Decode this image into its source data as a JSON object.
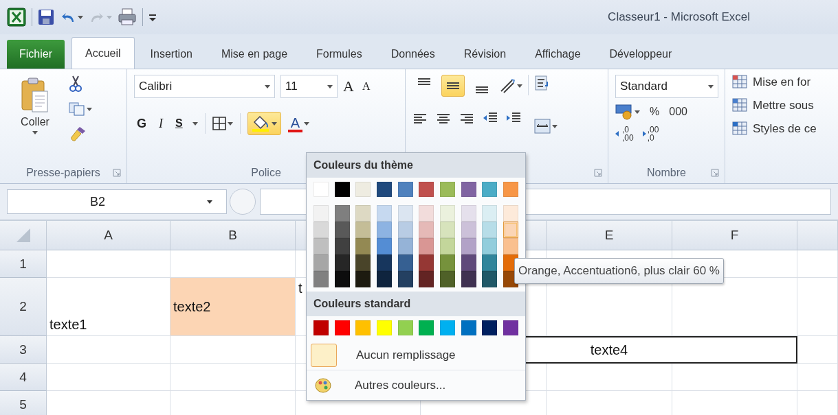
{
  "window": {
    "title": "Classeur1 - Microsoft Excel"
  },
  "tabs": [
    {
      "label": "Fichier",
      "kind": "file",
      "selected": false
    },
    {
      "label": "Accueil",
      "kind": "tab",
      "selected": true
    },
    {
      "label": "Insertion",
      "kind": "tab",
      "selected": false
    },
    {
      "label": "Mise en page",
      "kind": "tab",
      "selected": false
    },
    {
      "label": "Formules",
      "kind": "tab",
      "selected": false
    },
    {
      "label": "Données",
      "kind": "tab",
      "selected": false
    },
    {
      "label": "Révision",
      "kind": "tab",
      "selected": false
    },
    {
      "label": "Affichage",
      "kind": "tab",
      "selected": false
    },
    {
      "label": "Développeur",
      "kind": "tab",
      "selected": false
    }
  ],
  "ribbon": {
    "clipboard": {
      "paste_label": "Coller",
      "group_label": "Presse-papiers"
    },
    "font": {
      "family": "Calibri",
      "size": "11",
      "grow": "A",
      "shrink": "A",
      "bold": "G",
      "italic": "I",
      "underline": "S",
      "font_color": "A",
      "fill_open": true,
      "group_label": "Police"
    },
    "alignment": {
      "vertical": [
        {
          "selected": false
        },
        {
          "selected": true
        },
        {
          "selected": false
        }
      ]
    },
    "number": {
      "format": "Standard",
      "percent": "%",
      "thousands": "000",
      "decimals": [
        {
          "lines": [
            ",0",
            ",00"
          ]
        },
        {
          "lines": [
            ",00",
            ",0"
          ]
        }
      ],
      "group_label": "Nombre"
    },
    "styles": {
      "items": [
        {
          "label": "Mise en for"
        },
        {
          "label": "Mettre sous"
        },
        {
          "label": "Styles de ce"
        }
      ]
    }
  },
  "formula_bar": {
    "name_box": "B2"
  },
  "sheet": {
    "columns": [
      {
        "label": "A"
      },
      {
        "label": "B"
      },
      {},
      {},
      {
        "label": "E"
      },
      {
        "label": "F"
      },
      {}
    ],
    "rows": [
      {
        "label": "1",
        "cells": [
          {},
          {},
          {},
          {},
          {},
          {},
          {}
        ]
      },
      {
        "label": "2",
        "cells": [
          {
            "text": "texte1",
            "at_bottom": true
          },
          {
            "text": "texte2",
            "color": "#fcd5b4"
          },
          {
            "text": "t",
            "at_top": true
          },
          {},
          {},
          {},
          {}
        ]
      },
      {
        "label": "3",
        "cells": [
          {},
          {},
          {},
          {
            "text": "texte4",
            "bordered": true,
            "merge_right": true
          },
          {
            "merge_right": true
          },
          {},
          {}
        ]
      },
      {
        "label": "4",
        "cells": [
          {},
          {},
          {},
          {},
          {},
          {},
          {}
        ]
      },
      {
        "label": "5",
        "cells": [
          {},
          {},
          {},
          {},
          {},
          {},
          {}
        ]
      }
    ]
  },
  "fill_menu": {
    "theme_heading": "Couleurs du thème",
    "theme_colors": [
      {
        "color": "#ffffff",
        "selected": false
      },
      {
        "color": "#000000",
        "selected": false
      },
      {
        "color": "#eeece1",
        "selected": false
      },
      {
        "color": "#1f497d",
        "selected": false
      },
      {
        "color": "#4f81bd",
        "selected": false
      },
      {
        "color": "#c0504d",
        "selected": false
      },
      {
        "color": "#9bbb59",
        "selected": false
      },
      {
        "color": "#8064a2",
        "selected": false
      },
      {
        "color": "#4bacc6",
        "selected": false
      },
      {
        "color": "#f79646",
        "selected": false
      }
    ],
    "theme_shades": [
      {
        "shades": [
          {
            "color": "#f2f2f2",
            "selected": false
          },
          {
            "color": "#d9d9d9",
            "selected": false
          },
          {
            "color": "#bfbfbf",
            "selected": false
          },
          {
            "color": "#a6a6a6",
            "selected": false
          },
          {
            "color": "#808080",
            "selected": false
          }
        ]
      },
      {
        "shades": [
          {
            "color": "#7f7f7f",
            "selected": false
          },
          {
            "color": "#595959",
            "selected": false
          },
          {
            "color": "#404040",
            "selected": false
          },
          {
            "color": "#262626",
            "selected": false
          },
          {
            "color": "#0d0d0d",
            "selected": false
          }
        ]
      },
      {
        "shades": [
          {
            "color": "#ddd9c3",
            "selected": false
          },
          {
            "color": "#c4bd97",
            "selected": false
          },
          {
            "color": "#938953",
            "selected": false
          },
          {
            "color": "#494429",
            "selected": false
          },
          {
            "color": "#1d1b10",
            "selected": false
          }
        ]
      },
      {
        "shades": [
          {
            "color": "#c6d9f0",
            "selected": false
          },
          {
            "color": "#8db3e2",
            "selected": false
          },
          {
            "color": "#548dd4",
            "selected": false
          },
          {
            "color": "#17365d",
            "selected": false
          },
          {
            "color": "#0f243e",
            "selected": false
          }
        ]
      },
      {
        "shades": [
          {
            "color": "#dbe5f1",
            "selected": false
          },
          {
            "color": "#b8cce4",
            "selected": false
          },
          {
            "color": "#95b3d7",
            "selected": false
          },
          {
            "color": "#366092",
            "selected": false
          },
          {
            "color": "#244061",
            "selected": false
          }
        ]
      },
      {
        "shades": [
          {
            "color": "#f2dcdb",
            "selected": false
          },
          {
            "color": "#e5b9b7",
            "selected": false
          },
          {
            "color": "#d99694",
            "selected": false
          },
          {
            "color": "#953734",
            "selected": false
          },
          {
            "color": "#632423",
            "selected": false
          }
        ]
      },
      {
        "shades": [
          {
            "color": "#ebf1dd",
            "selected": false
          },
          {
            "color": "#d7e3bc",
            "selected": false
          },
          {
            "color": "#c3d69b",
            "selected": false
          },
          {
            "color": "#76923c",
            "selected": false
          },
          {
            "color": "#4f6128",
            "selected": false
          }
        ]
      },
      {
        "shades": [
          {
            "color": "#e5e0ec",
            "selected": false
          },
          {
            "color": "#ccc1d9",
            "selected": false
          },
          {
            "color": "#b2a2c7",
            "selected": false
          },
          {
            "color": "#5f497a",
            "selected": false
          },
          {
            "color": "#3f3151",
            "selected": false
          }
        ]
      },
      {
        "shades": [
          {
            "color": "#dbeef3",
            "selected": false
          },
          {
            "color": "#b7dde8",
            "selected": false
          },
          {
            "color": "#92cddc",
            "selected": false
          },
          {
            "color": "#31859b",
            "selected": false
          },
          {
            "color": "#205867",
            "selected": false
          }
        ]
      },
      {
        "shades": [
          {
            "color": "#fdeada",
            "selected": false
          },
          {
            "color": "#fbd5b5",
            "selected": true
          },
          {
            "color": "#fac08f",
            "selected": false
          },
          {
            "color": "#e36c09",
            "selected": false
          },
          {
            "color": "#974806",
            "selected": false
          }
        ]
      }
    ],
    "standard_heading": "Couleurs standard",
    "standard_colors": [
      {
        "color": "#c00000",
        "selected": false
      },
      {
        "color": "#ff0000",
        "selected": false
      },
      {
        "color": "#ffc000",
        "selected": false
      },
      {
        "color": "#ffff00",
        "selected": false
      },
      {
        "color": "#92d050",
        "selected": false
      },
      {
        "color": "#00b050",
        "selected": false
      },
      {
        "color": "#00b0f0",
        "selected": false
      },
      {
        "color": "#0070c0",
        "selected": false
      },
      {
        "color": "#002060",
        "selected": false
      },
      {
        "color": "#7030a0",
        "selected": false
      }
    ],
    "items": [
      {
        "kind": "no_fill",
        "label": "Aucun remplissage"
      },
      {
        "kind": "more",
        "label": "Autres couleurs..."
      }
    ]
  },
  "tooltip": {
    "text": "Orange, Accentuation6, plus clair 60 %"
  }
}
